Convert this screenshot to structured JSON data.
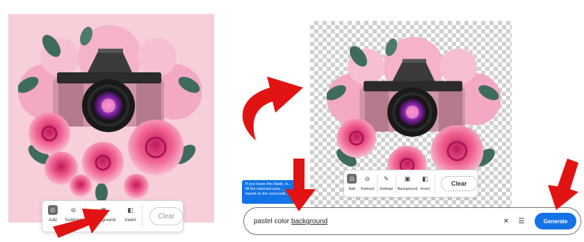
{
  "left_panel": {
    "toolbar": {
      "tools": [
        {
          "label": "Add",
          "icon": "add-circle-icon",
          "active": true
        },
        {
          "label": "Subtract",
          "icon": "subtract-circle-icon",
          "active": false
        },
        {
          "label": "Background",
          "icon": "background-image-icon",
          "active": false
        },
        {
          "label": "Invert",
          "icon": "invert-icon",
          "active": false
        }
      ],
      "clear_label": "Clear"
    }
  },
  "right_panel": {
    "tooltip": "If you leave this blank, w... fill the selected area ... based on the surroundi...",
    "toolbar": {
      "tools": [
        {
          "label": "Add",
          "icon": "add-circle-icon",
          "active": true
        },
        {
          "label": "Subtract",
          "icon": "subtract-circle-icon",
          "active": false
        },
        {
          "label": "Settings",
          "icon": "brush-settings-icon",
          "active": false
        },
        {
          "label": "Background",
          "icon": "background-image-icon",
          "active": false
        },
        {
          "label": "Invert",
          "icon": "invert-icon",
          "active": false
        }
      ],
      "clear_label": "Clear"
    },
    "prompt": {
      "value_prefix": "pastel color ",
      "value_underlined": "background",
      "clear_icon": "close-icon",
      "settings_icon": "sliders-icon",
      "generate_label": "Generate"
    }
  },
  "colors": {
    "accent_blue": "#1473e6",
    "arrow_red": "#e21313",
    "canvas_pink": "#f6cfd8"
  }
}
